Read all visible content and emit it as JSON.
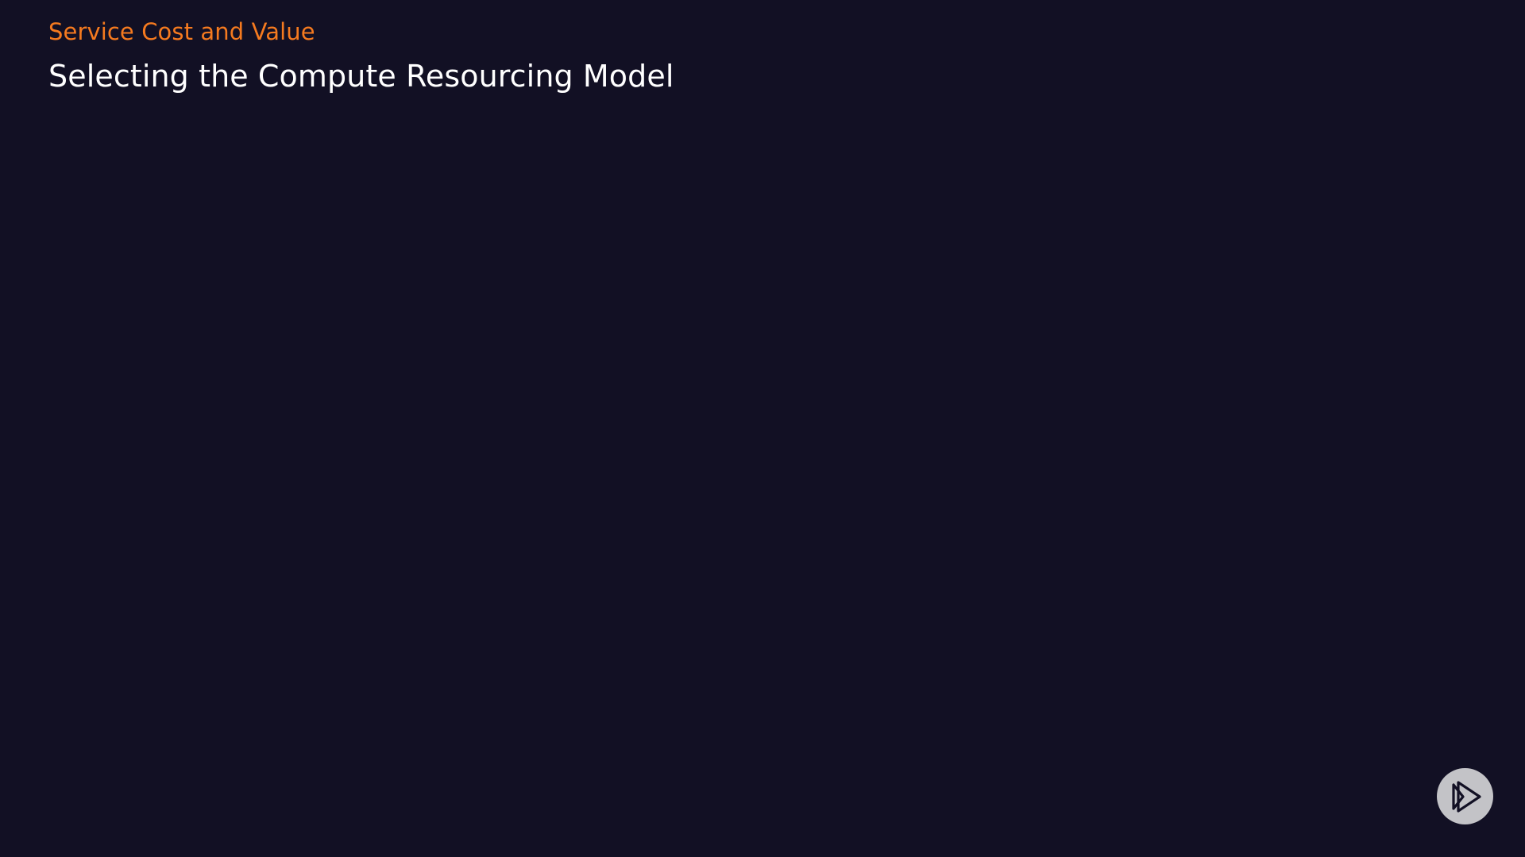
{
  "slide": {
    "section_label": "Service Cost and Value",
    "title": "Selecting the Compute Resourcing Model"
  },
  "brand": {
    "icon": "play-logo-icon"
  },
  "colors": {
    "background": "#121024",
    "accent": "#f57a1f",
    "title": "#ffffff",
    "brand_circle": "#c3c3c7"
  }
}
